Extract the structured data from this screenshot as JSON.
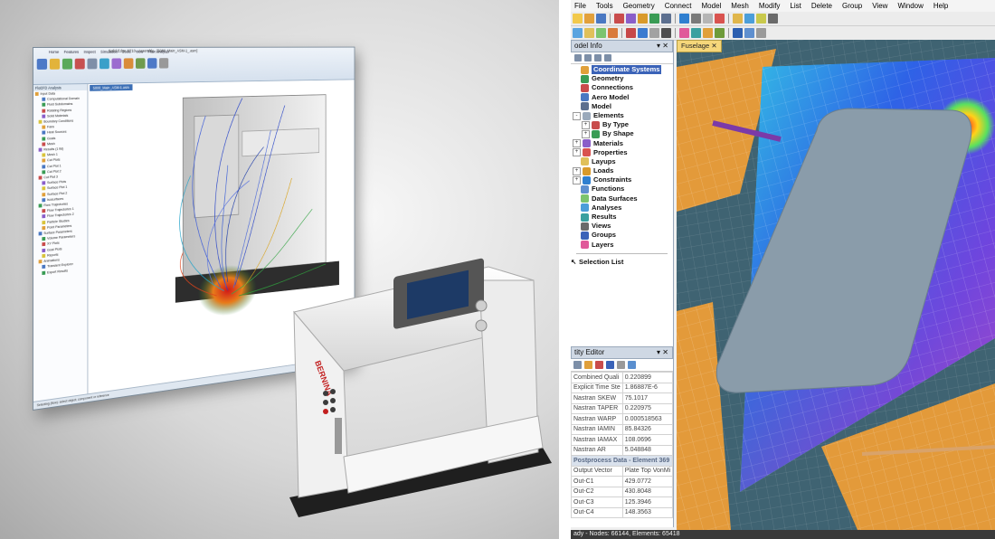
{
  "left_panel": {
    "cad_window": {
      "title": "Solid Edge ST10 - Assembly - [5000_Main_ASM-1_.asm]",
      "ribbon_tabs": [
        "Home",
        "Features",
        "Inspect",
        "Simulation",
        "Tools",
        "View",
        "Flow Analysis"
      ],
      "document_tab": "5000_Main_ASM-1.asm",
      "tree_title": "FloEFD Analysis",
      "tree_rows": [
        "Input Data",
        "Computational Domain",
        "Fluid Subdomains",
        "Rotating Regions",
        "Solid Materials",
        "Boundary Conditions",
        "Fans",
        "Heat Sources",
        "Goals",
        "Mesh",
        "Results (1 fld)",
        "Mesh 1",
        "Cut Plots",
        "Cut Plot 1",
        "Cut Plot 2",
        "Cut Plot 3",
        "Surface Plots",
        "Surface Plot 1",
        "Surface Plot 2",
        "Isosurfaces",
        "Flow Trajectories",
        "Flow Trajectories 1",
        "Flow Trajectories 2",
        "Particle Studies",
        "Point Parameters",
        "Surface Parameters",
        "Volume Parameters",
        "XY Plots",
        "Goal Plots",
        "Reports",
        "Animations",
        "Transient Explorer",
        "Export Results"
      ],
      "status_text": "Selecting (flow): select object; component or reference"
    },
    "machine_brand": "BERNINA",
    "colors": {
      "accent": "#3c6fb5"
    }
  },
  "right_panel": {
    "menu": [
      "File",
      "Tools",
      "Geometry",
      "Connect",
      "Model",
      "Mesh",
      "Modify",
      "List",
      "Delete",
      "Group",
      "View",
      "Window",
      "Help"
    ],
    "model_info": {
      "title": "odel Info",
      "tree": [
        {
          "label": "Coordinate Systems",
          "icon": "coordinate-systems-icon",
          "level": 0,
          "selected": true
        },
        {
          "label": "Geometry",
          "icon": "geometry-icon",
          "level": 0
        },
        {
          "label": "Connections",
          "icon": "connections-icon",
          "level": 0
        },
        {
          "label": "Aero Model",
          "icon": "aero-model-icon",
          "level": 0
        },
        {
          "label": "Model",
          "icon": "model-icon",
          "level": 0
        },
        {
          "label": "Elements",
          "icon": "elements-icon",
          "level": 0,
          "expander": "-"
        },
        {
          "label": "By Type",
          "icon": "by-type-icon",
          "level": 1,
          "expander": "+"
        },
        {
          "label": "By Shape",
          "icon": "by-shape-icon",
          "level": 1,
          "expander": "+"
        },
        {
          "label": "Materials",
          "icon": "materials-icon",
          "level": 0,
          "expander": "+"
        },
        {
          "label": "Properties",
          "icon": "properties-icon",
          "level": 0,
          "expander": "+"
        },
        {
          "label": "Layups",
          "icon": "layups-icon",
          "level": 0
        },
        {
          "label": "Loads",
          "icon": "loads-icon",
          "level": 0,
          "expander": "+"
        },
        {
          "label": "Constraints",
          "icon": "constraints-icon",
          "level": 0,
          "expander": "+"
        },
        {
          "label": "Functions",
          "icon": "functions-icon",
          "level": 0
        },
        {
          "label": "Data Surfaces",
          "icon": "data-surfaces-icon",
          "level": 0
        },
        {
          "label": "Analyses",
          "icon": "analyses-icon",
          "level": 0
        },
        {
          "label": "Results",
          "icon": "results-icon",
          "level": 0
        },
        {
          "label": "Views",
          "icon": "views-icon",
          "level": 0
        },
        {
          "label": "Groups",
          "icon": "groups-icon",
          "level": 0
        },
        {
          "label": "Layers",
          "icon": "layers-icon",
          "level": 0
        }
      ],
      "selection_list": "Selection List"
    },
    "entity_editor": {
      "title": "tity Editor",
      "rows": [
        [
          "Combined Quali",
          "0.220899"
        ],
        [
          "Explicit Time Ste",
          "1.86887E-6"
        ],
        [
          "Nastran SKEW",
          "75.1017"
        ],
        [
          "Nastran TAPER",
          "0.220975"
        ],
        [
          "Nastran WARP",
          "0.000518563"
        ],
        [
          "Nastran IAMIN",
          "85.84326"
        ],
        [
          "Nastran IAMAX",
          "108.0696"
        ],
        [
          "Nastran AR",
          "5.048848"
        ]
      ],
      "group_header": "Postprocess Data - Element 369",
      "result_rows": [
        [
          "Output Vector",
          "Plate Top VonMi"
        ],
        [
          "Out-C1",
          "429.0772"
        ],
        [
          "Out-C2",
          "430.8048"
        ],
        [
          "Out-C3",
          "125.3946"
        ],
        [
          "Out-C4",
          "148.3563"
        ]
      ]
    },
    "view_tab": "Fuselage",
    "status": "ady - Nodes: 66144,  Elements: 65418",
    "colors": {
      "selection": "#3b63b8",
      "tab": "#f6d77a"
    }
  }
}
